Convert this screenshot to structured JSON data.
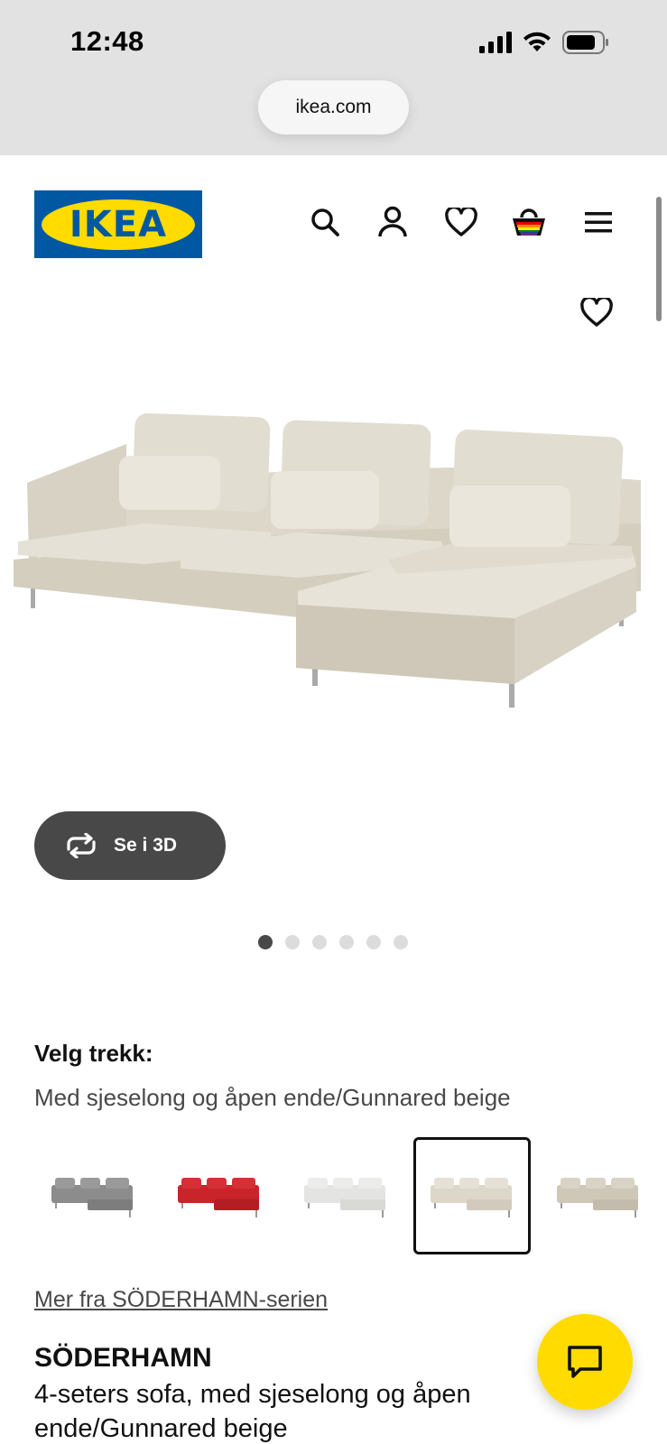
{
  "status_bar": {
    "time": "12:48"
  },
  "browser": {
    "url": "ikea.com"
  },
  "header": {
    "logo_text": "IKEA",
    "icons": [
      "search-icon",
      "account-icon",
      "heart-icon",
      "cart-icon",
      "menu-icon"
    ]
  },
  "product": {
    "view_3d_label": "Se i 3D",
    "image_count": 6,
    "active_image": 1,
    "choose_cover_label": "Velg trekk:",
    "choose_cover_value": "Med sjeselong og åpen ende/Gunnared beige",
    "swatches": [
      {
        "color": "#8c8c8c",
        "selected": false
      },
      {
        "color": "#c8242a",
        "selected": false
      },
      {
        "color": "#e4e4e2",
        "selected": false
      },
      {
        "color": "#ddd7ca",
        "selected": true
      },
      {
        "color": "#cfc8b9",
        "selected": false
      }
    ],
    "series_link": "Mer fra SÖDERHAMN-serien",
    "name": "SÖDERHAMN",
    "description": "4-seters sofa, med sjeselong og åpen ende/Gunnared beige"
  },
  "colors": {
    "brand_blue": "#0058a3",
    "brand_yellow": "#ffdb00",
    "button_dark": "#484848"
  }
}
